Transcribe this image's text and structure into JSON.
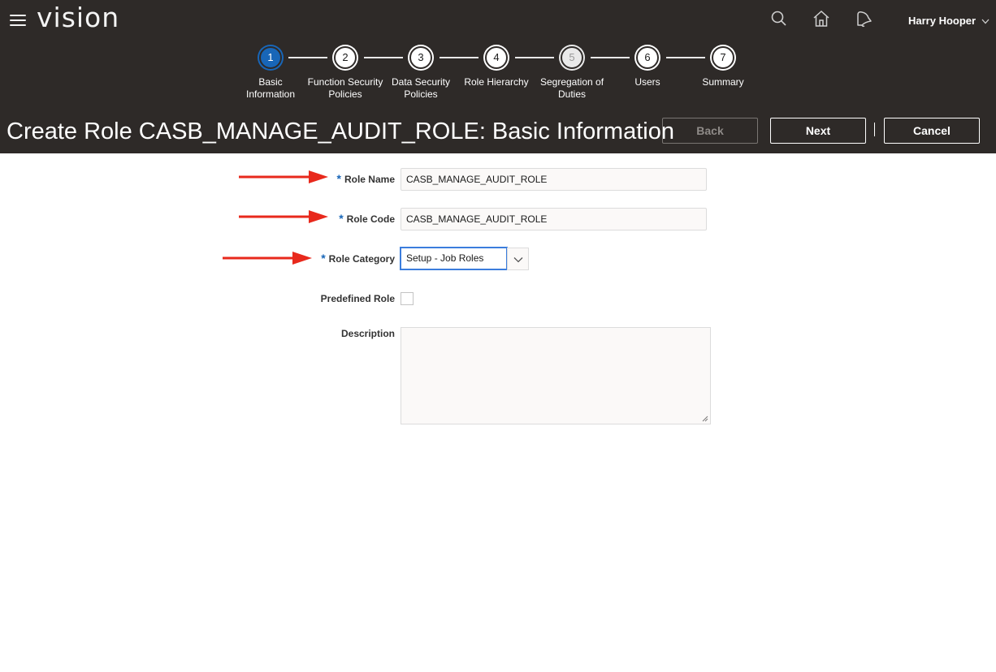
{
  "header": {
    "app_name": "vision",
    "user_name": "Harry Hooper",
    "icons": [
      "menu-icon",
      "search-icon",
      "home-icon",
      "notifications-icon",
      "chevron-down-icon"
    ]
  },
  "train": {
    "stops": [
      {
        "number": "1",
        "label": "Basic Information",
        "state": "active"
      },
      {
        "number": "2",
        "label": "Function Security Policies",
        "state": "normal"
      },
      {
        "number": "3",
        "label": "Data Security Policies",
        "state": "normal"
      },
      {
        "number": "4",
        "label": "Role Hierarchy",
        "state": "normal"
      },
      {
        "number": "5",
        "label": "Segregation of Duties",
        "state": "disabled"
      },
      {
        "number": "6",
        "label": "Users",
        "state": "normal"
      },
      {
        "number": "7",
        "label": "Summary",
        "state": "normal"
      }
    ]
  },
  "page": {
    "title": "Create Role CASB_MANAGE_AUDIT_ROLE: Basic Information"
  },
  "buttons": {
    "back": "Back",
    "next": "Next",
    "cancel": "Cancel"
  },
  "form": {
    "role_name": {
      "label": "Role Name",
      "value": "CASB_MANAGE_AUDIT_ROLE",
      "required": true
    },
    "role_code": {
      "label": "Role Code",
      "value": "CASB_MANAGE_AUDIT_ROLE",
      "required": true
    },
    "role_category": {
      "label": "Role Category",
      "value": "Setup - Job Roles",
      "required": true
    },
    "predefined_role": {
      "label": "Predefined Role",
      "checked": false
    },
    "description": {
      "label": "Description",
      "value": ""
    },
    "required_marker": "*"
  },
  "colors": {
    "header_bg": "#2e2a28",
    "accent": "#1866b8",
    "annotation_arrow": "#e8291c"
  }
}
